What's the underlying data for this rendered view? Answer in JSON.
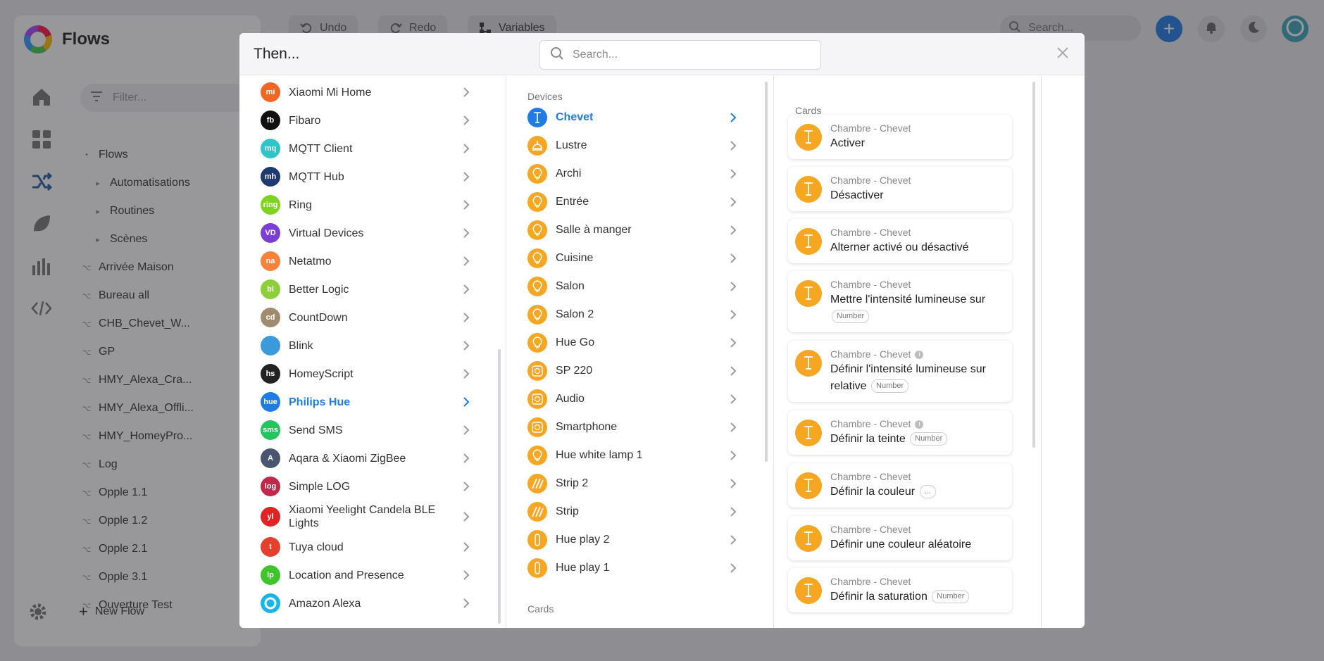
{
  "app": {
    "title": "Flows",
    "toolbar": {
      "undo": "Undo",
      "redo": "Redo",
      "variables": "Variables"
    },
    "search_placeholder": "Search...",
    "filter_placeholder": "Filter...",
    "tree": [
      {
        "label": "Flows",
        "level": 0,
        "kind": "folder-open"
      },
      {
        "label": "Automatisations",
        "level": 1,
        "kind": "folder"
      },
      {
        "label": "Routines",
        "level": 1,
        "kind": "folder"
      },
      {
        "label": "Scènes",
        "level": 1,
        "kind": "folder"
      },
      {
        "label": "Arrivée Maison",
        "level": 0,
        "kind": "flow"
      },
      {
        "label": "Bureau all",
        "level": 0,
        "kind": "flow"
      },
      {
        "label": "CHB_Chevet_W...",
        "level": 0,
        "kind": "flow"
      },
      {
        "label": "GP",
        "level": 0,
        "kind": "flow"
      },
      {
        "label": "HMY_Alexa_Cra...",
        "level": 0,
        "kind": "flow"
      },
      {
        "label": "HMY_Alexa_Offli...",
        "level": 0,
        "kind": "flow"
      },
      {
        "label": "HMY_HomeyPro...",
        "level": 0,
        "kind": "flow"
      },
      {
        "label": "Log",
        "level": 0,
        "kind": "flow"
      },
      {
        "label": "Opple 1.1",
        "level": 0,
        "kind": "flow"
      },
      {
        "label": "Opple 1.2",
        "level": 0,
        "kind": "flow"
      },
      {
        "label": "Opple 2.1",
        "level": 0,
        "kind": "flow"
      },
      {
        "label": "Opple 3.1",
        "level": 0,
        "kind": "flow"
      },
      {
        "label": "Ouverture Test",
        "level": 0,
        "kind": "flow"
      }
    ],
    "new_flow": "New Flow"
  },
  "modal": {
    "title": "Then...",
    "search_placeholder": "Search...",
    "apps": [
      {
        "label": "Xiaomi Mi Home",
        "color": "#f26522",
        "glyph": "mi"
      },
      {
        "label": "Fibaro",
        "color": "#111111",
        "glyph": "fb"
      },
      {
        "label": "MQTT Client",
        "color": "#2ec4c9",
        "glyph": "mq"
      },
      {
        "label": "MQTT Hub",
        "color": "#1e3a6e",
        "glyph": "mh"
      },
      {
        "label": "Ring",
        "color": "#7ed321",
        "glyph": "ring"
      },
      {
        "label": "Virtual Devices",
        "color": "#7b3fd6",
        "glyph": "VD"
      },
      {
        "label": "Netatmo",
        "color": "#f5833b",
        "glyph": "na"
      },
      {
        "label": "Better Logic",
        "color": "#8ccf38",
        "glyph": "bl"
      },
      {
        "label": "CountDown",
        "color": "#a08b6e",
        "glyph": "cd"
      },
      {
        "label": "Blink",
        "color": "#3b9ad9",
        "glyph": "blink"
      },
      {
        "label": "HomeyScript",
        "color": "#222222",
        "glyph": "hs"
      },
      {
        "label": "Philips Hue",
        "color": "#1f7be6",
        "glyph": "hue",
        "active": true
      },
      {
        "label": "Send SMS",
        "color": "#22c55e",
        "glyph": "sms"
      },
      {
        "label": "Aqara & Xiaomi ZigBee",
        "color": "#4a5570",
        "glyph": "A"
      },
      {
        "label": "Simple LOG",
        "color": "#c0284a",
        "glyph": "log"
      },
      {
        "label": "Xiaomi Yeelight Candela BLE Lights",
        "color": "#e02424",
        "glyph": "yl"
      },
      {
        "label": "Tuya cloud",
        "color": "#e4402d",
        "glyph": "t"
      },
      {
        "label": "Location and Presence",
        "color": "#3ec52a",
        "glyph": "lp"
      },
      {
        "label": "Amazon Alexa",
        "color": "#19b5e8",
        "glyph": "alexa"
      }
    ],
    "devices_label": "Devices",
    "devices": [
      {
        "label": "Chevet",
        "icon": "lamp",
        "active": true
      },
      {
        "label": "Lustre",
        "icon": "ceiling"
      },
      {
        "label": "Archi",
        "icon": "bulb"
      },
      {
        "label": "Entrée",
        "icon": "bulb"
      },
      {
        "label": "Salle à manger",
        "icon": "bulb"
      },
      {
        "label": "Cuisine",
        "icon": "bulb"
      },
      {
        "label": "Salon",
        "icon": "bulb"
      },
      {
        "label": "Salon 2",
        "icon": "bulb"
      },
      {
        "label": "Hue Go",
        "icon": "bulb"
      },
      {
        "label": "SP 220",
        "icon": "plug"
      },
      {
        "label": "Audio",
        "icon": "plug"
      },
      {
        "label": "Smartphone",
        "icon": "plug"
      },
      {
        "label": "Hue white lamp 1",
        "icon": "bulb"
      },
      {
        "label": "Strip 2",
        "icon": "strip"
      },
      {
        "label": "Strip",
        "icon": "strip"
      },
      {
        "label": "Hue play 2",
        "icon": "play"
      },
      {
        "label": "Hue play 1",
        "icon": "play"
      }
    ],
    "cards_label_mid": "Cards",
    "cards_label": "Cards",
    "cards": [
      {
        "device": "Chambre - Chevet",
        "title": "Activer",
        "badge": "",
        "info": false
      },
      {
        "device": "Chambre - Chevet",
        "title": "Désactiver",
        "badge": "",
        "info": false
      },
      {
        "device": "Chambre - Chevet",
        "title": "Alterner activé ou désactivé",
        "badge": "",
        "info": false
      },
      {
        "device": "Chambre - Chevet",
        "title": "Mettre l'intensité lumineuse sur",
        "badge": "Number",
        "info": false,
        "badge_newline": true
      },
      {
        "device": "Chambre - Chevet",
        "title": "Définir l'intensité lumineuse sur relative",
        "badge": "Number",
        "info": true
      },
      {
        "device": "Chambre - Chevet",
        "title": "Définir la teinte",
        "badge": "Number",
        "info": true
      },
      {
        "device": "Chambre - Chevet",
        "title": "Définir la couleur",
        "badge": "...",
        "info": false
      },
      {
        "device": "Chambre - Chevet",
        "title": "Définir une couleur aléatoire",
        "badge": "",
        "info": false
      },
      {
        "device": "Chambre - Chevet",
        "title": "Définir la saturation",
        "badge": "Number",
        "info": false
      }
    ]
  }
}
